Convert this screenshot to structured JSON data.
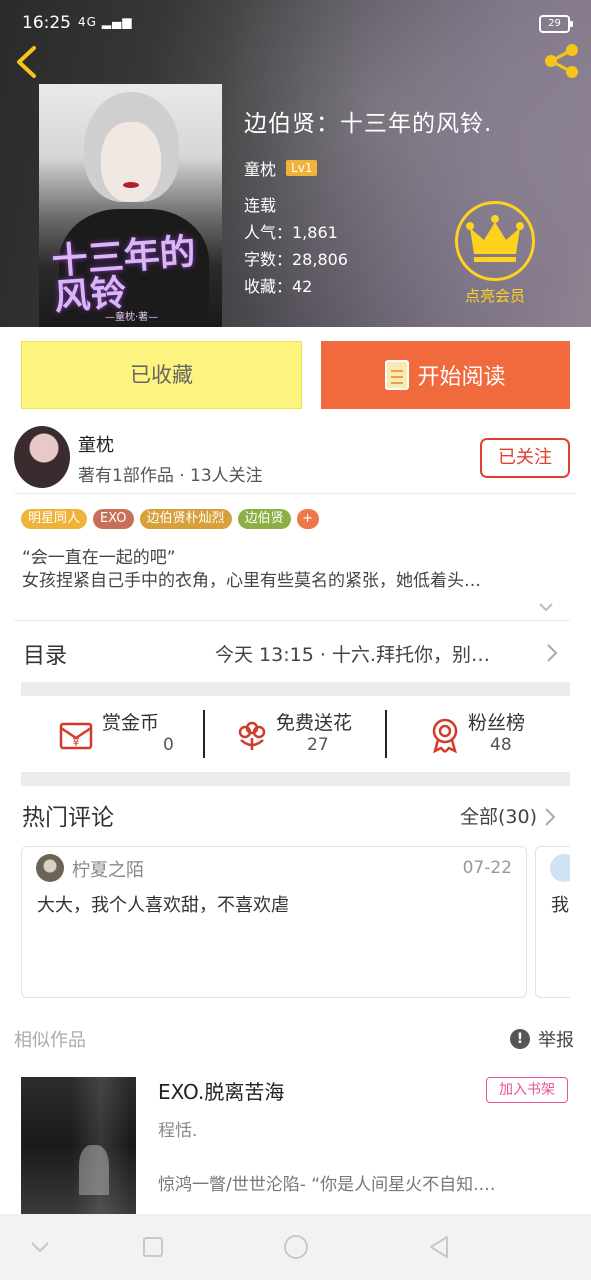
{
  "status_bar": {
    "time": "16:25",
    "signal": "4G",
    "battery": "29"
  },
  "book": {
    "title": "边伯贤：十三年的风铃.",
    "author": "童枕",
    "level": "Lv1",
    "status": "连载",
    "popularity": "人气：1,861",
    "word_count": "字数：28,806",
    "favorites": "收藏：42",
    "cover_title": "十三年的风铃",
    "cover_subtitle": "—童枕·著—"
  },
  "vip": {
    "label": "点亮会员"
  },
  "actions": {
    "favorited_label": "已收藏",
    "read_label": "开始阅读"
  },
  "author_card": {
    "name": "童枕",
    "stats": "著有1部作品 · 13人关注",
    "follow_label": "已关注"
  },
  "tags": [
    {
      "label": "明星同人",
      "color": "#f0b33a"
    },
    {
      "label": "EXO",
      "color": "#c76f57"
    },
    {
      "label": "边伯贤朴灿烈",
      "color": "#d7a03b"
    },
    {
      "label": "边伯贤",
      "color": "#8db046"
    },
    {
      "label": "+",
      "color": "#f0774a"
    }
  ],
  "intro": {
    "line1": "“会一直在一起的吧”",
    "line2": "女孩捏紧自己手中的衣角，心里有些莫名的紧张，她低着头…"
  },
  "catalog": {
    "label": "目录",
    "latest": "今天 13:15 · 十六.拜托你，别…"
  },
  "stats": [
    {
      "label": "赏金币",
      "value": "0",
      "icon": "coin-envelope-icon"
    },
    {
      "label": "免费送花",
      "value": "27",
      "icon": "flower-icon"
    },
    {
      "label": "粉丝榜",
      "value": "48",
      "icon": "medal-icon"
    }
  ],
  "comments": {
    "title": "热门评论",
    "all_label": "全部(30)",
    "items": [
      {
        "user": "柠夏之陌",
        "date": "07-22",
        "text": "大大，我个人喜欢甜，不喜欢虐"
      },
      {
        "text": "我"
      }
    ]
  },
  "similar": {
    "label": "相似作品",
    "report_label": "举报",
    "item": {
      "title": "EXO.脱离苦海",
      "author": "程恬.",
      "desc": "惊鸿一瞥/世世沦陷- “你是人间星火不自知.…",
      "add_label": "加入书架"
    }
  },
  "colors": {
    "accent_orange": "#f06a3e",
    "fav_yellow": "#fcf47e",
    "follow_red": "#e0402f",
    "vip_gold": "#ffd21e",
    "shelf_pink": "#e6559a"
  }
}
